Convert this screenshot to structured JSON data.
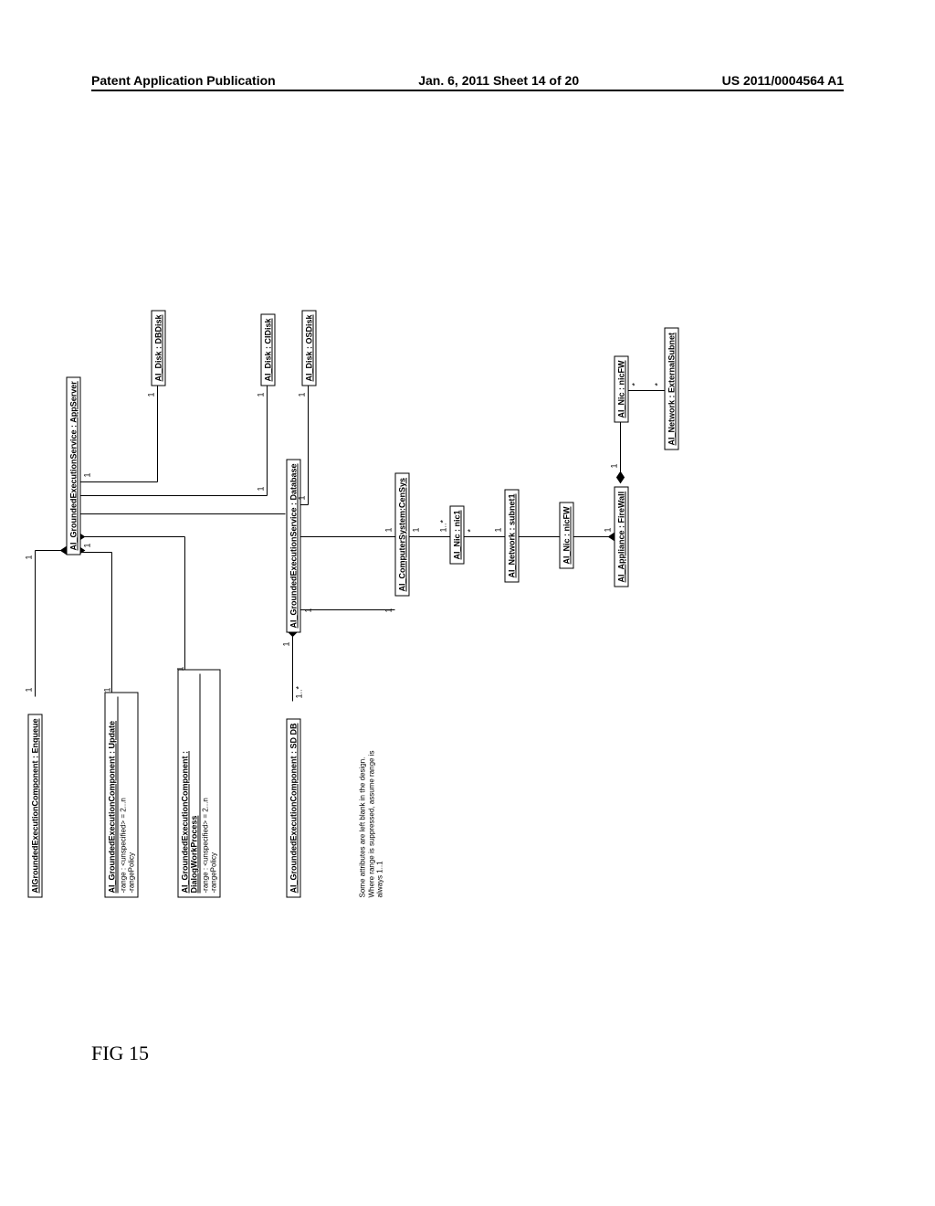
{
  "header": {
    "left": "Patent Application Publication",
    "center": "Jan. 6, 2011  Sheet 14 of 20",
    "right": "US 2011/0004564 A1"
  },
  "figure_label": "FIG 15",
  "boxes": {
    "enqueue": "AIGroundedExecutionComponent : Enqueue",
    "appserver": "AI_GroundedExecutionService : AppServer",
    "update_title": "AI_GroundedExecutionComponent : Update",
    "update_attr1": "-range : <unspecified> = 2...n",
    "update_attr2": "-rangePolicy",
    "dialog_title": "AI_GroundedExecutionComponent : DialogWorkProcess",
    "dialog_attr1": "-range : <unspecified> = 2...n",
    "dialog_attr2": "-rangePolicy",
    "sddb": "AI_GroundedExecutionComponent : SD DB",
    "database": "AI_GroundedExecutionService : Database",
    "dbdisk": "AI_Disk : DBDisk",
    "cidisk": "AI_Disk : CIDisk",
    "osdisk": "AI_Disk : OSDisk",
    "censys": "AI_ComputerSystem:CenSys",
    "nic1": "AI_Nic : nic1",
    "subnet1": "AI_Network : subnet1",
    "nicfw": "AI_Nic : nicFW",
    "firewall": "AI_Appliance : FireWall",
    "nicfw2": "AI_Nic : nicFW",
    "extsubnet": "AI_Network : ExternalSubnet"
  },
  "note": {
    "line1": "Some attributes are left blank in the design.",
    "line2": "Where range is suppressed, assume range is",
    "line3": "always 1..1"
  },
  "mult": {
    "one": "1",
    "star": "*",
    "onestar": "1..*"
  }
}
